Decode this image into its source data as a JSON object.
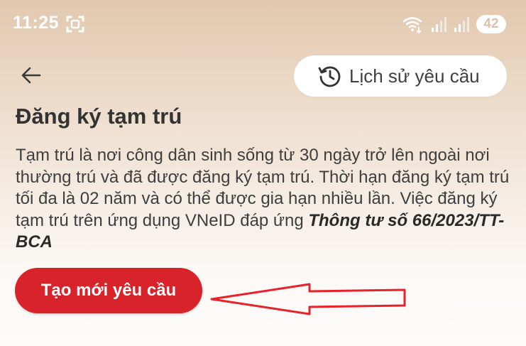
{
  "status_bar": {
    "time": "11:25",
    "battery_level": "42",
    "icons": [
      "screenshot-icon",
      "wifi-icon",
      "signal-icon",
      "signal-icon",
      "battery-icon"
    ]
  },
  "header": {
    "back_icon": "arrow-left-icon",
    "history_button": {
      "icon": "history-clock-icon",
      "label": "Lịch sử yêu cầu"
    }
  },
  "main": {
    "title": "Đăng ký tạm trú",
    "description": "Tạm trú là nơi công dân sinh sống từ 30 ngày trở lên ngoài nơi thường trú và đã được đăng ký tạm trú. Thời hạn đăng ký tạm trú tối đa là 02 năm và có thể được gia hạn nhiều lần. Việc đăng ký tạm trú trên ứng dụng VNeID đáp ứng ",
    "description_bold": "Thông tư số 66/2023/TT-BCA",
    "create_button_label": "Tạo mới yêu cầu"
  },
  "colors": {
    "primary_red": "#d8232a",
    "annotation_red": "#e8222a",
    "text": "#333333"
  }
}
